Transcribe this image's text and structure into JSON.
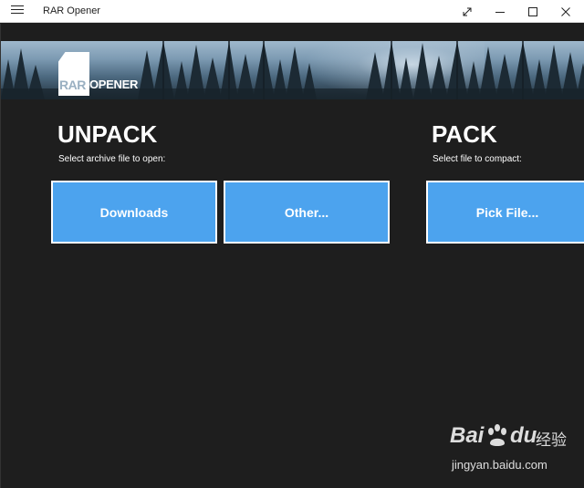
{
  "window": {
    "title": "RAR Opener",
    "menu_icon": "hamburger-icon",
    "controls": [
      "expand-icon",
      "minimize-icon",
      "maximize-icon",
      "close-icon"
    ]
  },
  "banner": {
    "logo_rar": "RAR",
    "logo_opener": "OPENER"
  },
  "unpack": {
    "title": "UNPACK",
    "subtitle": "Select archive file to open:",
    "buttons": [
      "Downloads",
      "Other..."
    ]
  },
  "pack": {
    "title": "PACK",
    "subtitle": "Select file to compact:",
    "button": "Pick File..."
  },
  "watermark": {
    "brand_latin_1": "Bai",
    "brand_latin_2": "du",
    "brand_cn": "经验",
    "url": "jingyan.baidu.com"
  },
  "colors": {
    "background": "#1e1e1e",
    "button": "#4ca3ee",
    "button_border": "#ffffff",
    "titlebar": "#ffffff"
  }
}
